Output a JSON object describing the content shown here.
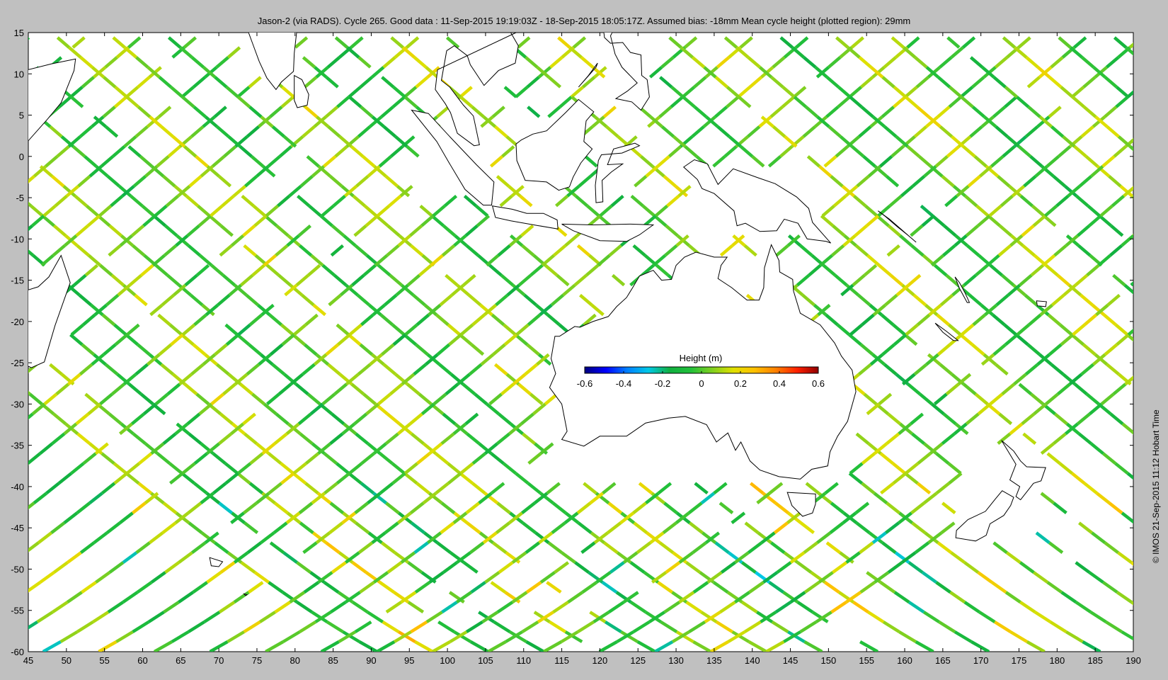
{
  "title": "Jason-2 (via RADS). Cycle 265. Good data : 11-Sep-2015 19:19:03Z - 18-Sep-2015 18:05:17Z. Assumed bias: -18mm  Mean cycle height (plotted region): 29mm",
  "credit": "© IMOS 21-Sep-2015 11:12 Hobart Time",
  "map": {
    "lon_range": [
      45,
      190
    ],
    "lat_range": [
      -60,
      15
    ],
    "x_ticks": [
      45,
      50,
      55,
      60,
      65,
      70,
      75,
      80,
      85,
      90,
      95,
      100,
      105,
      110,
      115,
      120,
      125,
      130,
      135,
      140,
      145,
      150,
      155,
      160,
      165,
      170,
      175,
      180,
      185,
      190
    ],
    "y_ticks": [
      15,
      10,
      5,
      0,
      -5,
      -10,
      -15,
      -20,
      -25,
      -30,
      -35,
      -40,
      -45,
      -50,
      -55,
      -60
    ],
    "track_color_meaning": "sea surface height anomaly along Jason-2 ground tracks"
  },
  "colorbar": {
    "label": "Height (m)",
    "range": [
      -0.6,
      0.6
    ],
    "ticks": [
      "-0.6",
      "-0.4",
      "-0.2",
      "0",
      "0.2",
      "0.4",
      "0.6"
    ],
    "colors": [
      "#00007f",
      "#0000ff",
      "#0080ff",
      "#00c8e6",
      "#10b040",
      "#22c03a",
      "#80d020",
      "#e0e000",
      "#ffc000",
      "#ff8000",
      "#ff2000",
      "#900000"
    ]
  },
  "colors": {
    "background": "#c0c0c0",
    "plot_area": "#ffffff",
    "coastline": "#000000"
  }
}
